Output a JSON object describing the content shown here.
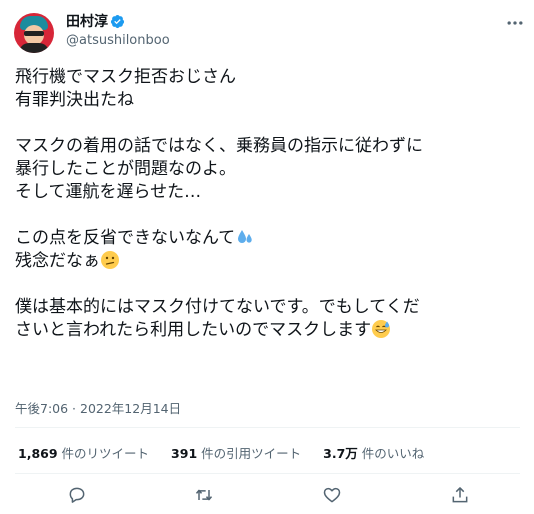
{
  "author": {
    "name": "田村淳",
    "handle": "@atsushilonboo"
  },
  "tweet": {
    "lines": [
      "飛行機でマスク拒否おじさん",
      "有罪判決出たね",
      "",
      "マスクの着用の話ではなく、乗務員の指示に従わずに",
      "暴行したことが問題なのよ。",
      "そして運航を遅らせた…",
      "",
      "この点を反省できないなんて",
      "残念だなぁ",
      "",
      "僕は基本的にはマスク付けてないです。でもしてくだ",
      "さいと言われたら利用したいのでマスクします"
    ],
    "emojis": [
      "sweat-droplets-emoji",
      "confused-face-emoji",
      "grinning-sweat-face-emoji"
    ]
  },
  "timestamp": "午後7:06 · 2022年12月14日",
  "stats": {
    "retweets_count": "1,869",
    "retweets_label": "件のリツイート",
    "quotes_count": "391",
    "quotes_label": "件の引用ツイート",
    "likes_count": "3.7万",
    "likes_label": "件のいいね"
  },
  "icons": [
    "verified-badge-icon",
    "more-icon",
    "reply-icon",
    "retweet-icon",
    "like-icon",
    "share-icon"
  ],
  "colors": {
    "text": "#0f1419",
    "secondary": "#536471",
    "verified": "#1d9bf0",
    "divider": "#eff3f4"
  }
}
